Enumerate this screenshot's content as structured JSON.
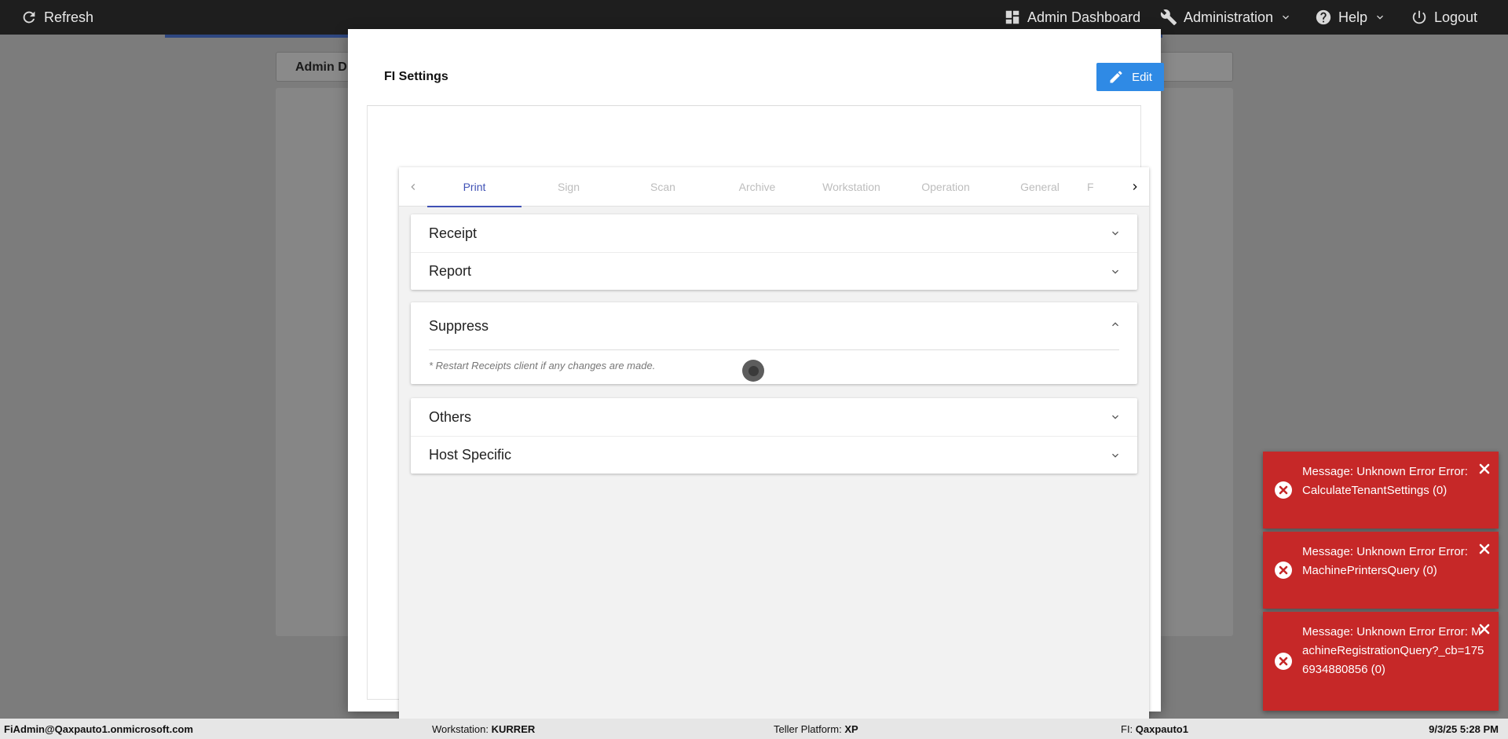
{
  "topbar": {
    "refresh_label": "Refresh",
    "admin_dashboard_label": "Admin Dashboard",
    "administration_label": "Administration",
    "help_label": "Help",
    "logout_label": "Logout"
  },
  "background": {
    "header_title": "Admin D"
  },
  "modal": {
    "title": "FI Settings",
    "edit_label": "Edit",
    "tabs": [
      {
        "label": "Print",
        "active": true
      },
      {
        "label": "Sign"
      },
      {
        "label": "Scan"
      },
      {
        "label": "Archive"
      },
      {
        "label": "Workstation"
      },
      {
        "label": "Operation"
      },
      {
        "label": "General"
      },
      {
        "label": "F"
      }
    ],
    "group1": [
      "Receipt",
      "Report"
    ],
    "suppress": {
      "title": "Suppress",
      "note": "* Restart Receipts client if any changes are made."
    },
    "group2": [
      "Others",
      "Host Specific"
    ]
  },
  "toasts": [
    {
      "message": "Message: Unknown Error Error: CalculateTenantSettings (0)"
    },
    {
      "message": "Message: Unknown Error Error: MachinePrintersQuery (0)"
    },
    {
      "message": "Message: Unknown Error Error: MachineRegistrationQuery?_cb=1756934880856 (0)"
    }
  ],
  "footer": {
    "user": "FiAdmin@Qaxpauto1.onmicrosoft.com",
    "workstation_label": "Workstation:",
    "workstation_value": "KURRER",
    "teller_label": "Teller Platform:",
    "teller_value": "XP",
    "fi_label": "FI:",
    "fi_value": "Qaxpauto1",
    "datetime": "9/3/25 5:28 PM"
  },
  "colors": {
    "primary": "#2f8ae5",
    "tab_active": "#3f51b5",
    "error": "#c62828",
    "topbar": "#1e1e1e"
  }
}
